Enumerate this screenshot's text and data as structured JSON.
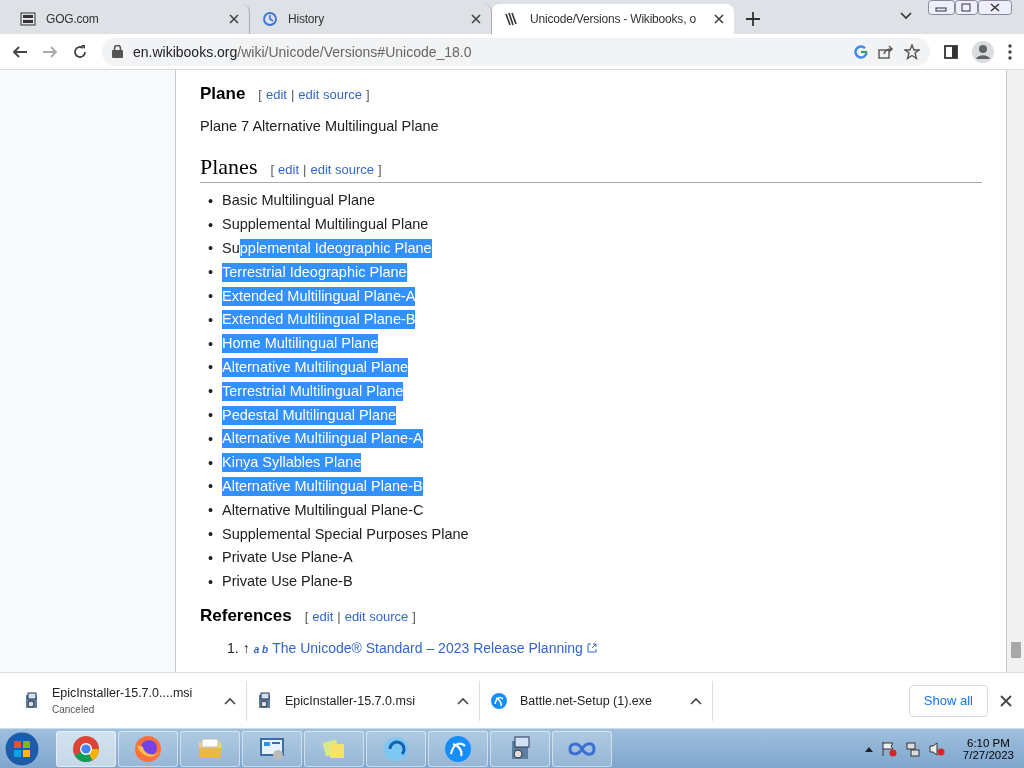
{
  "tabs": [
    {
      "label": "GOG.com",
      "kind": "gog",
      "selected": false
    },
    {
      "label": "History",
      "kind": "history",
      "selected": false
    },
    {
      "label": "Unicode/Versions - Wikibooks, o",
      "kind": "wikibooks",
      "selected": true
    }
  ],
  "address": {
    "host": "en.wikibooks.org",
    "path": "/wiki/Unicode/Versions#Unicode_18.0"
  },
  "plane_section": {
    "heading": "Plane",
    "edit": {
      "open": "[",
      "links": [
        "edit",
        "edit source"
      ],
      "sep": "|",
      "close": "]"
    },
    "text": "Plane 7 Alternative Multilingual Plane"
  },
  "planes_section": {
    "heading": "Planes",
    "edit": {
      "open": "[",
      "links": [
        "edit",
        "edit source"
      ],
      "sep": "|",
      "close": "]"
    },
    "bullet": "•",
    "items": [
      {
        "parts": [
          {
            "text": "Basic Multilingual Plane",
            "selected": false
          }
        ]
      },
      {
        "parts": [
          {
            "text": "Supplemental Multilingual Plane",
            "selected": false
          }
        ]
      },
      {
        "parts": [
          {
            "text": "Su",
            "selected": false
          },
          {
            "text": "pplemental Ideographic Plane",
            "selected": true
          }
        ]
      },
      {
        "parts": [
          {
            "text": "Terrestrial Ideographic Plane",
            "selected": true
          }
        ]
      },
      {
        "parts": [
          {
            "text": "Extended Multilingual Plane-A",
            "selected": true
          }
        ]
      },
      {
        "parts": [
          {
            "text": "Extended Multilingual Plane-B",
            "selected": true
          }
        ]
      },
      {
        "parts": [
          {
            "text": "Home Multilingual Plane",
            "selected": true
          }
        ]
      },
      {
        "parts": [
          {
            "text": "Alternative Multilingual Plane",
            "selected": true
          }
        ]
      },
      {
        "parts": [
          {
            "text": "Terrestrial Multilingual Plane",
            "selected": true
          }
        ]
      },
      {
        "parts": [
          {
            "text": "Pedestal Multilingual Plane",
            "selected": true
          }
        ]
      },
      {
        "parts": [
          {
            "text": "Alternative Multilingual Plane-A",
            "selected": true
          }
        ]
      },
      {
        "parts": [
          {
            "text": "Kinya Syllables Plane",
            "selected": true
          }
        ]
      },
      {
        "parts": [
          {
            "text": "Alternative Multilingual Plane-B",
            "selected": true
          }
        ]
      },
      {
        "parts": [
          {
            "text": "Alternative Multilingual Plane-C",
            "selected": false
          }
        ]
      },
      {
        "parts": [
          {
            "text": "Supplemental Special Purposes Plane",
            "selected": false
          }
        ]
      },
      {
        "parts": [
          {
            "text": "Private Use Plane-A",
            "selected": false
          }
        ]
      },
      {
        "parts": [
          {
            "text": "Private Use Plane-B",
            "selected": false
          }
        ]
      }
    ]
  },
  "references": {
    "heading": "References",
    "edit": {
      "open": "[",
      "links": [
        "edit",
        "edit source"
      ],
      "sep": "|",
      "close": "]"
    },
    "items": [
      {
        "number": "1.",
        "backref": "↑",
        "backlinks": "a b",
        "link": "The Unicode® Standard – 2023 Release Planning"
      }
    ]
  },
  "downloads": [
    {
      "name": "EpicInstaller-15.7.0....msi",
      "status": "Canceled",
      "kind": "installer"
    },
    {
      "name": "EpicInstaller-15.7.0.msi",
      "kind": "installer"
    },
    {
      "name": "Battle.net-Setup (1).exe",
      "kind": "battlenet"
    }
  ],
  "show_all": "Show all",
  "taskbar": {
    "apps": [
      {
        "kind": "chrome",
        "selected": true
      },
      {
        "kind": "firefox",
        "selected": false
      },
      {
        "kind": "explorer",
        "selected": false
      },
      {
        "kind": "control",
        "selected": false
      },
      {
        "kind": "notes",
        "selected": false
      },
      {
        "kind": "swirl",
        "selected": false
      },
      {
        "kind": "battlenet",
        "selected": false
      },
      {
        "kind": "installer",
        "selected": false
      },
      {
        "kind": "infinity",
        "selected": false
      }
    ],
    "time": "6:10 PM",
    "date": "7/27/2023"
  }
}
